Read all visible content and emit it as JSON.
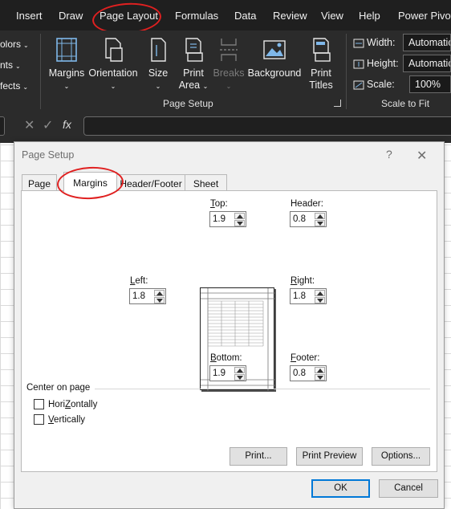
{
  "menu": {
    "tabs": [
      "Insert",
      "Draw",
      "Page Layout",
      "Formulas",
      "Data",
      "Review",
      "View",
      "Help",
      "Power Pivot"
    ]
  },
  "ribbon": {
    "left_items": [
      "olors",
      "nts",
      "fects"
    ],
    "page_setup": {
      "margins": "Margins",
      "orientation": "Orientation",
      "size": "Size",
      "print_area_1": "Print",
      "print_area_2": "Area",
      "breaks": "Breaks",
      "background": "Background",
      "print_titles_1": "Print",
      "print_titles_2": "Titles",
      "group_label": "Page Setup"
    },
    "scale_to_fit": {
      "width_label": "Width:",
      "width_value": "Automatic",
      "height_label": "Height:",
      "height_value": "Automatic",
      "scale_label": "Scale:",
      "scale_value": "100%",
      "group_label": "Scale to Fit"
    }
  },
  "formula_bar": {
    "fx": "fx"
  },
  "dialog": {
    "title": "Page Setup",
    "help": "?",
    "close": "✕",
    "tabs": [
      {
        "label": "Page",
        "active": false
      },
      {
        "label": "Margins",
        "active": true
      },
      {
        "label": "Header/Footer",
        "active": false
      },
      {
        "label": "Sheet",
        "active": false
      }
    ],
    "fields": {
      "top": {
        "label_key": "T",
        "label_rest": "op:",
        "value": "1.9"
      },
      "header": {
        "label_key": "",
        "label_rest": "Header:",
        "value": "0.8"
      },
      "left": {
        "label_key": "L",
        "label_rest": "eft:",
        "value": "1.8"
      },
      "right": {
        "label_key": "R",
        "label_rest": "ight:",
        "value": "1.8"
      },
      "bottom": {
        "label_key": "B",
        "label_rest": "ottom:",
        "value": "1.9"
      },
      "footer": {
        "label_key": "F",
        "label_rest": "ooter:",
        "value": "0.8"
      }
    },
    "center_on_page": {
      "label": "Center on page",
      "horizontally_key": "Z",
      "horizontally_pre": "Hori",
      "horizontally_post": "ontally",
      "horizontally_checked": false,
      "vertically_key": "V",
      "vertically_post": "ertically",
      "vertically_checked": false
    },
    "buttons": {
      "print": "Print...",
      "print_preview": "Print Preview",
      "options": "Options...",
      "ok": "OK",
      "cancel": "Cancel"
    }
  },
  "colors": {
    "ribbon_bg": "#2b2b2b",
    "menu_bg": "#1f1f1f",
    "dialog_bg": "#f0f0f0",
    "annotation": "#e02020",
    "default_button_border": "#0078d7"
  }
}
